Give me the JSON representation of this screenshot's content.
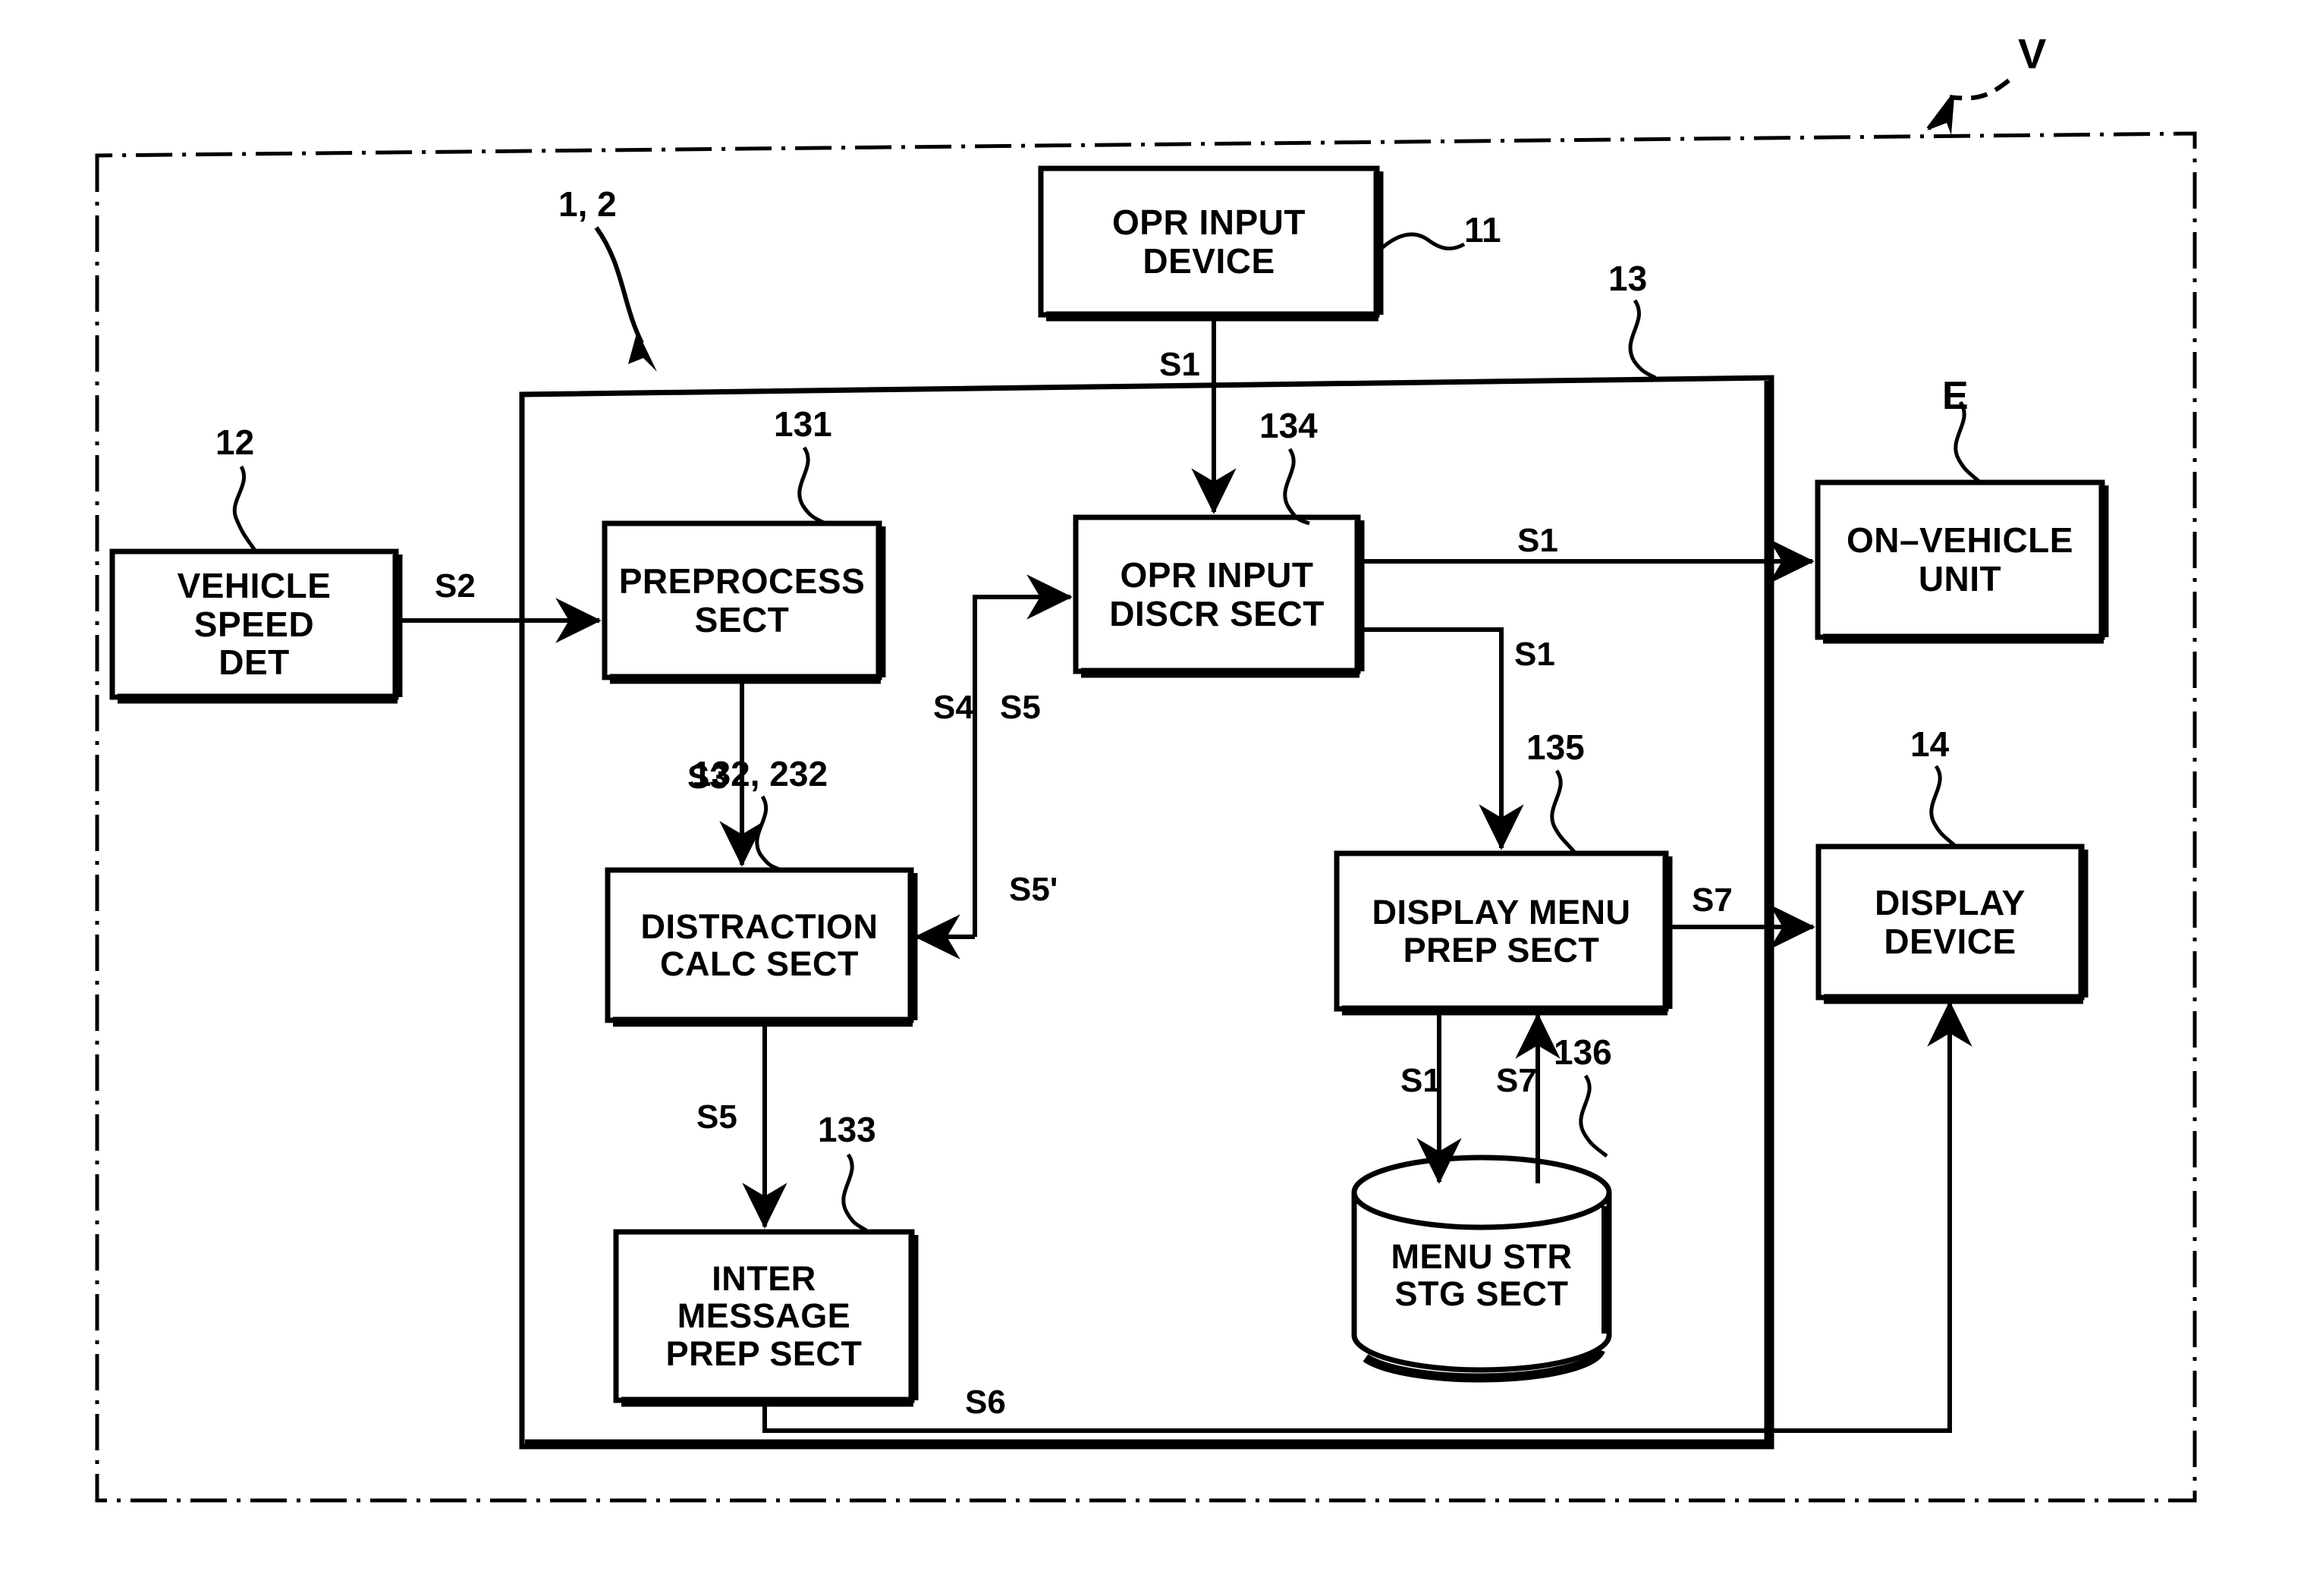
{
  "figure": {
    "type": "patent-block-diagram",
    "outer_boundary_ref": "V",
    "inner_unit_ref": "13",
    "controller_ref": "1, 2"
  },
  "boxes": [
    {
      "id": "vehicle_speed_det",
      "label": "VEHICLE\nSPEED\nDET",
      "ref": "12"
    },
    {
      "id": "opr_input_device",
      "label": "OPR INPUT\nDEVICE",
      "ref": "11"
    },
    {
      "id": "preprocess_sect",
      "label": "PREPROCESS\nSECT",
      "ref": "131"
    },
    {
      "id": "opr_input_discr",
      "label": "OPR INPUT\nDISCR SECT",
      "ref": "134"
    },
    {
      "id": "on_vehicle_unit",
      "label": "ON–VEHICLE\nUNIT",
      "ref": "E"
    },
    {
      "id": "distraction_calc",
      "label": "DISTRACTION\nCALC SECT",
      "ref": "132, 232"
    },
    {
      "id": "display_menu_prep",
      "label": "DISPLAY MENU\nPREP SECT",
      "ref": "135"
    },
    {
      "id": "display_device",
      "label": "DISPLAY\nDEVICE",
      "ref": "14"
    },
    {
      "id": "inter_message",
      "label": "INTER\nMESSAGE\nPREP SECT",
      "ref": "133"
    },
    {
      "id": "menu_str_stg",
      "label": "MENU STR\nSTG SECT",
      "ref": "136"
    }
  ],
  "ref_labels": {
    "v": "V",
    "e": "E",
    "eleven": "11",
    "twelve": "12",
    "thirteen": "13",
    "fourteen": "14",
    "one_two": "1, 2",
    "r131": "131",
    "r132_232": "132, 232",
    "r133": "133",
    "r134": "134",
    "r135": "135",
    "r136": "136"
  },
  "signals": {
    "s1_top": "S1",
    "s1_to_unit": "S1",
    "s1_to_menu": "S1",
    "s1_to_store": "S1",
    "s2": "S2",
    "s3": "S3",
    "s4": "S4",
    "s5_at_discr": "S5",
    "s5_prime": "S5'",
    "s5_to_msg": "S5",
    "s6": "S6",
    "s7_out": "S7",
    "s7_from_store": "S7"
  },
  "colors": {
    "ink": "#000000",
    "paper": "#ffffff"
  }
}
